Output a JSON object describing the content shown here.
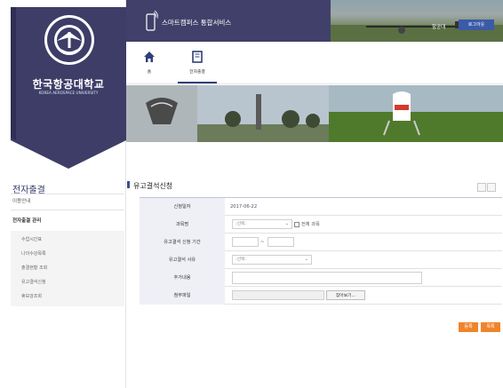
{
  "university": {
    "name_ko": "한국항공대학교",
    "name_en": "KOREA AEROSPACE UNIVERSITY"
  },
  "header": {
    "service_title": "스마트캠퍼스 통합서비스",
    "user_name": "항공대",
    "logout_label": "로그아웃"
  },
  "nav": {
    "home_label": "홈",
    "attendance_label": "전자출결"
  },
  "sidebar": {
    "title": "전자출결",
    "guide": "이용안내",
    "manage": "전자출결 관리",
    "items": [
      "수업시간표",
      "나의수강목록",
      "출결현황 조회",
      "유고결석신청",
      "휴보강조회"
    ]
  },
  "page": {
    "title": "유고결석신청"
  },
  "form": {
    "apply_date_label": "신청일자",
    "apply_date_value": "2017-06-22",
    "subject_label": "과목명",
    "subject_select": ":선택:",
    "all_subjects_label": "전체 과목",
    "period_label": "유고결석 신청 기간",
    "period_sep": "~",
    "reason_label": "유고결석 사유",
    "reason_select": ":선택:",
    "detail_label": "추가내용",
    "attachment_label": "첨부파일",
    "browse_label": "찾아보기..."
  },
  "buttons": {
    "register": "등록",
    "list": "목록"
  },
  "colors": {
    "navy": "#41406a",
    "accent_blue": "#3b5aa8",
    "button_orange": "#f0842c"
  }
}
